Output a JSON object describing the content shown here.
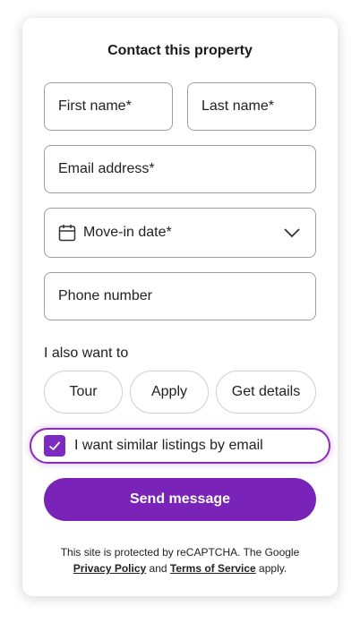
{
  "form": {
    "title": "Contact this property",
    "first_name_placeholder": "First name*",
    "last_name_placeholder": "Last name*",
    "email_placeholder": "Email address*",
    "move_in_label": "Move-in date*",
    "phone_placeholder": "Phone number",
    "also_label": "I also want to",
    "options": [
      "Tour",
      "Apply",
      "Get details"
    ],
    "consent_label": "I want similar listings by email",
    "consent_checked": true,
    "submit_label": "Send message"
  },
  "legal": {
    "text_before": "This site is protected by reCAPTCHA. The Google ",
    "privacy_link": "Privacy Policy",
    "and": " and ",
    "terms_link": "Terms of Service",
    "text_after": " apply."
  },
  "colors": {
    "accent": "#7a23b8",
    "border": "#9e9e9e"
  },
  "icons": {
    "calendar": "calendar-icon",
    "chevron": "chevron-down-icon",
    "check": "checkmark-icon"
  }
}
